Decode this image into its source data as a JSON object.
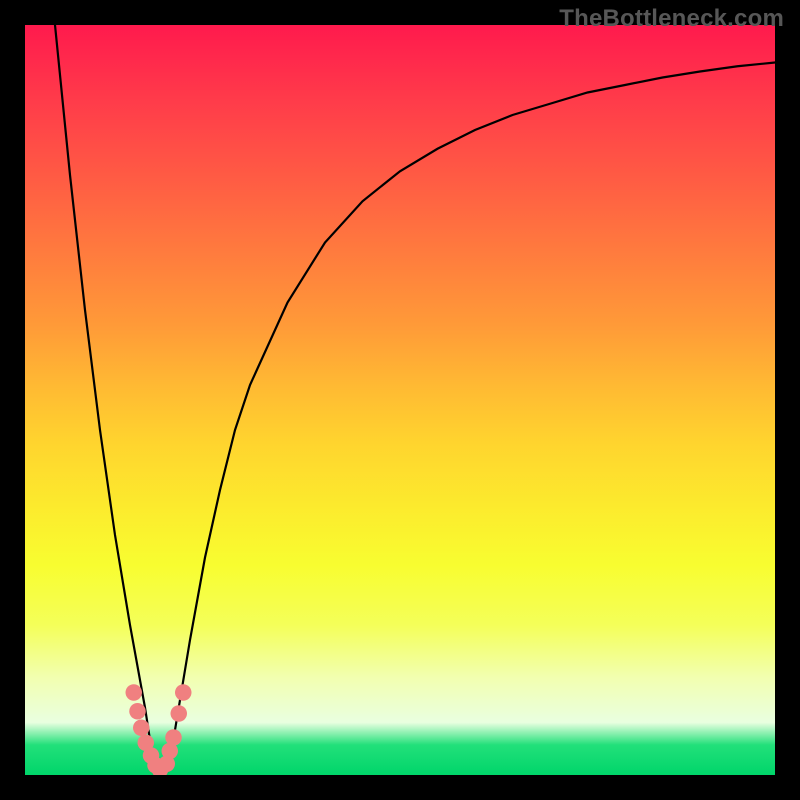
{
  "watermark": "TheBottleneck.com",
  "chart_data": {
    "type": "line",
    "title": "",
    "xlabel": "",
    "ylabel": "",
    "xlim": [
      0,
      100
    ],
    "ylim": [
      0,
      100
    ],
    "series": [
      {
        "name": "curve",
        "x": [
          4,
          6,
          8,
          10,
          12,
          14,
          16,
          17,
          18,
          20,
          22,
          24,
          26,
          28,
          30,
          35,
          40,
          45,
          50,
          55,
          60,
          65,
          70,
          75,
          80,
          85,
          90,
          95,
          100
        ],
        "y": [
          100,
          80,
          62,
          46,
          32,
          20,
          9,
          2.5,
          0,
          6,
          18,
          29,
          38,
          46,
          52,
          63,
          71,
          76.5,
          80.5,
          83.5,
          86,
          88,
          89.5,
          91,
          92,
          93,
          93.8,
          94.5,
          95
        ]
      }
    ],
    "markers": [
      {
        "x": 14.5,
        "y": 11,
        "r": 1.1
      },
      {
        "x": 15.0,
        "y": 8.5,
        "r": 1.1
      },
      {
        "x": 15.5,
        "y": 6.3,
        "r": 1.1
      },
      {
        "x": 16.1,
        "y": 4.3,
        "r": 1.1
      },
      {
        "x": 16.8,
        "y": 2.6,
        "r": 1.1
      },
      {
        "x": 17.4,
        "y": 1.3,
        "r": 1.1
      },
      {
        "x": 18.0,
        "y": 0.7,
        "r": 1.1
      },
      {
        "x": 18.9,
        "y": 1.5,
        "r": 1.1
      },
      {
        "x": 19.3,
        "y": 3.2,
        "r": 1.1
      },
      {
        "x": 19.8,
        "y": 5.0,
        "r": 1.1
      },
      {
        "x": 20.5,
        "y": 8.2,
        "r": 1.1
      },
      {
        "x": 21.1,
        "y": 11.0,
        "r": 1.1
      }
    ],
    "colors": {
      "curve": "#000000",
      "marker": "#f08080"
    }
  }
}
